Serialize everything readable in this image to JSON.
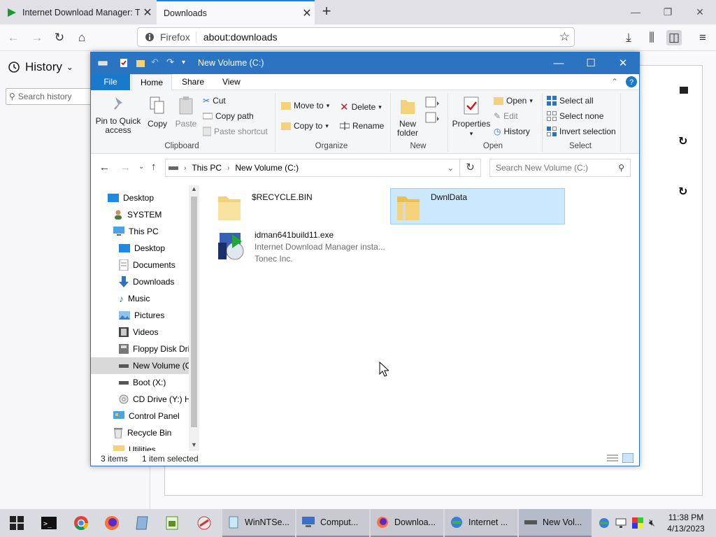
{
  "firefox": {
    "tabs": [
      {
        "title": "Internet Download Manager: T"
      },
      {
        "title": "Downloads"
      }
    ],
    "url_brand": "Firefox",
    "url": "about:downloads",
    "sidebar_title": "History",
    "sidebar_search_placeholder": "Search history"
  },
  "explorer": {
    "title": "New Volume (C:)",
    "ribbon_tabs": [
      "File",
      "Home",
      "Share",
      "View"
    ],
    "clipboard": {
      "pin": "Pin to Quick access",
      "copy": "Copy",
      "paste": "Paste",
      "cut": "Cut",
      "copy_path": "Copy path",
      "paste_shortcut": "Paste shortcut",
      "label": "Clipboard"
    },
    "organize": {
      "move_to": "Move to",
      "copy_to": "Copy to",
      "delete": "Delete",
      "rename": "Rename",
      "label": "Organize"
    },
    "new": {
      "new_folder_1": "New",
      "new_folder_2": "folder",
      "label": "New"
    },
    "open": {
      "properties": "Properties",
      "open": "Open",
      "edit": "Edit",
      "history": "History",
      "label": "Open"
    },
    "select": {
      "select_all": "Select all",
      "select_none": "Select none",
      "invert": "Invert selection",
      "label": "Select"
    },
    "breadcrumb": [
      "This PC",
      "New Volume (C:)"
    ],
    "search_placeholder": "Search New Volume (C:)",
    "nav": [
      {
        "label": "Desktop"
      },
      {
        "label": "SYSTEM"
      },
      {
        "label": "This PC"
      },
      {
        "label": "Desktop"
      },
      {
        "label": "Documents"
      },
      {
        "label": "Downloads"
      },
      {
        "label": "Music"
      },
      {
        "label": "Pictures"
      },
      {
        "label": "Videos"
      },
      {
        "label": "Floppy Disk Dri"
      },
      {
        "label": "New Volume (C"
      },
      {
        "label": "Boot (X:)"
      },
      {
        "label": "CD Drive (Y:) H"
      },
      {
        "label": "Control Panel"
      },
      {
        "label": "Recycle Bin"
      },
      {
        "label": "Utilities"
      }
    ],
    "files": [
      {
        "name": "$RECYCLE.BIN"
      },
      {
        "name": "DwnlData"
      },
      {
        "name": "idman641build11.exe",
        "desc": "Internet Download Manager insta...",
        "company": "Tonec Inc."
      }
    ],
    "status_count": "3 items",
    "status_selected": "1 item selected"
  },
  "taskbar": {
    "windows": [
      {
        "label": "WinNTSe..."
      },
      {
        "label": "Comput..."
      },
      {
        "label": "Downloa..."
      },
      {
        "label": "Internet ..."
      },
      {
        "label": "New Vol..."
      }
    ],
    "time": "11:38 PM",
    "date": "4/13/2023"
  },
  "colors": {
    "title_blue": "#2b74c2",
    "file_tab": "#1979ca",
    "selection": "#cce8ff",
    "folder": "#f4d27a"
  }
}
